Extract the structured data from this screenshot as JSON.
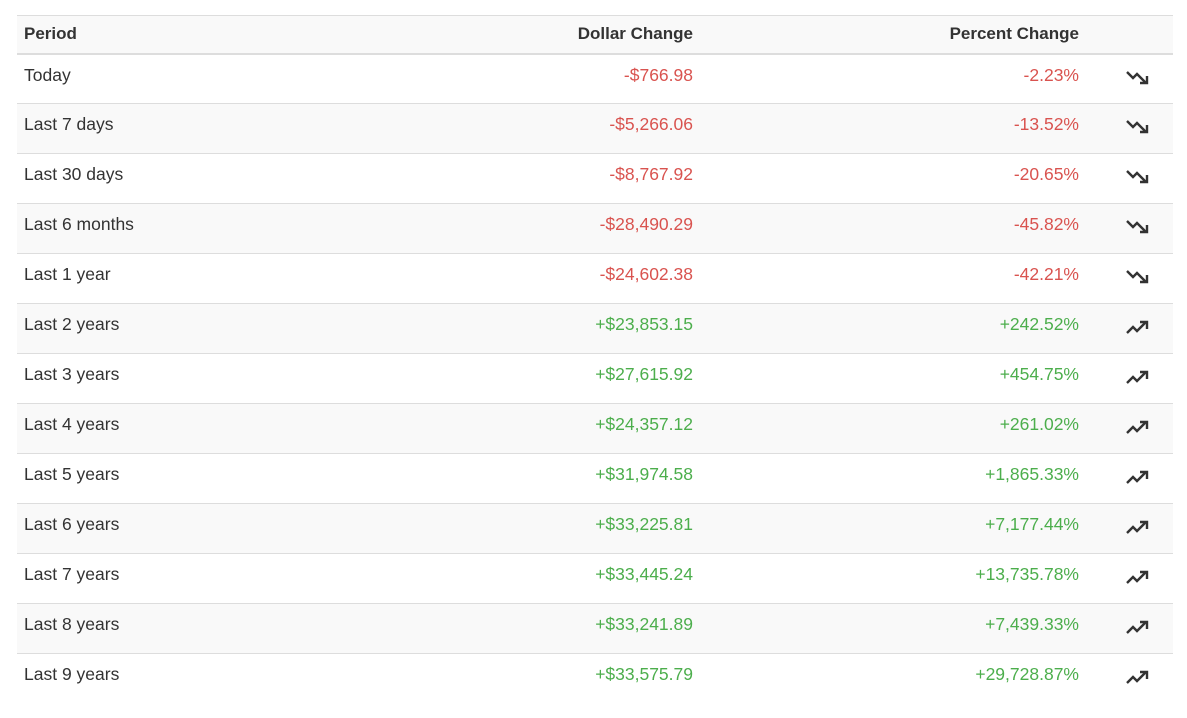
{
  "table": {
    "headers": {
      "period": "Period",
      "dollar": "Dollar Change",
      "percent": "Percent Change"
    },
    "rows": [
      {
        "period": "Today",
        "dollar": "-$766.98",
        "percent": "-2.23%",
        "trend": "down",
        "trend_icon": "trending-down-icon"
      },
      {
        "period": "Last 7 days",
        "dollar": "-$5,266.06",
        "percent": "-13.52%",
        "trend": "down",
        "trend_icon": "trending-down-icon"
      },
      {
        "period": "Last 30 days",
        "dollar": "-$8,767.92",
        "percent": "-20.65%",
        "trend": "down",
        "trend_icon": "trending-down-icon"
      },
      {
        "period": "Last 6 months",
        "dollar": "-$28,490.29",
        "percent": "-45.82%",
        "trend": "down",
        "trend_icon": "trending-down-icon"
      },
      {
        "period": "Last 1 year",
        "dollar": "-$24,602.38",
        "percent": "-42.21%",
        "trend": "down",
        "trend_icon": "trending-down-icon"
      },
      {
        "period": "Last 2 years",
        "dollar": "+$23,853.15",
        "percent": "+242.52%",
        "trend": "up",
        "trend_icon": "trending-up-icon"
      },
      {
        "period": "Last 3 years",
        "dollar": "+$27,615.92",
        "percent": "+454.75%",
        "trend": "up",
        "trend_icon": "trending-up-icon"
      },
      {
        "period": "Last 4 years",
        "dollar": "+$24,357.12",
        "percent": "+261.02%",
        "trend": "up",
        "trend_icon": "trending-up-icon"
      },
      {
        "period": "Last 5 years",
        "dollar": "+$31,974.58",
        "percent": "+1,865.33%",
        "trend": "up",
        "trend_icon": "trending-up-icon"
      },
      {
        "period": "Last 6 years",
        "dollar": "+$33,225.81",
        "percent": "+7,177.44%",
        "trend": "up",
        "trend_icon": "trending-up-icon"
      },
      {
        "period": "Last 7 years",
        "dollar": "+$33,445.24",
        "percent": "+13,735.78%",
        "trend": "up",
        "trend_icon": "trending-up-icon"
      },
      {
        "period": "Last 8 years",
        "dollar": "+$33,241.89",
        "percent": "+7,439.33%",
        "trend": "up",
        "trend_icon": "trending-up-icon"
      },
      {
        "period": "Last 9 years",
        "dollar": "+$33,575.79",
        "percent": "+29,728.87%",
        "trend": "up",
        "trend_icon": "trending-up-icon"
      }
    ]
  },
  "colors": {
    "negative": "#d9534f",
    "positive": "#4cae4c",
    "text": "#333333",
    "stripe": "#f9f9f9",
    "border": "#dddddd"
  }
}
